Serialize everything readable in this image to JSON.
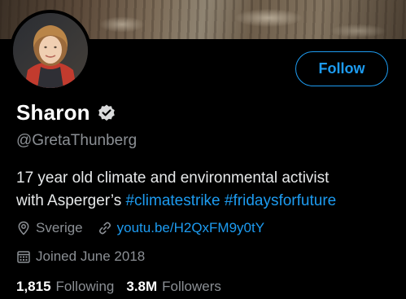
{
  "profile": {
    "display_name": "Sharon",
    "verified_icon": "verified-badge-icon",
    "handle": "@GretaThunberg",
    "follow_label": "Follow",
    "bio": {
      "line1": "17 year old climate and environmental activist",
      "line2_prefix": "with Asperger’s ",
      "hashtag1": "#climatestrike",
      "hashtag2": "#fridaysforfuture"
    },
    "location": "Sverige",
    "website": "youtu.be/H2QxFM9y0tY",
    "joined": "Joined June 2018",
    "following_count": "1,815",
    "following_label": "Following",
    "followers_count": "3.8M",
    "followers_label": "Followers"
  },
  "icons": {
    "location": "location-pin-icon",
    "link": "link-icon",
    "calendar": "calendar-icon"
  },
  "colors": {
    "background": "#000000",
    "accent": "#1d9bf0",
    "primary_text": "#ffffff",
    "secondary_text": "#8b8f94"
  }
}
